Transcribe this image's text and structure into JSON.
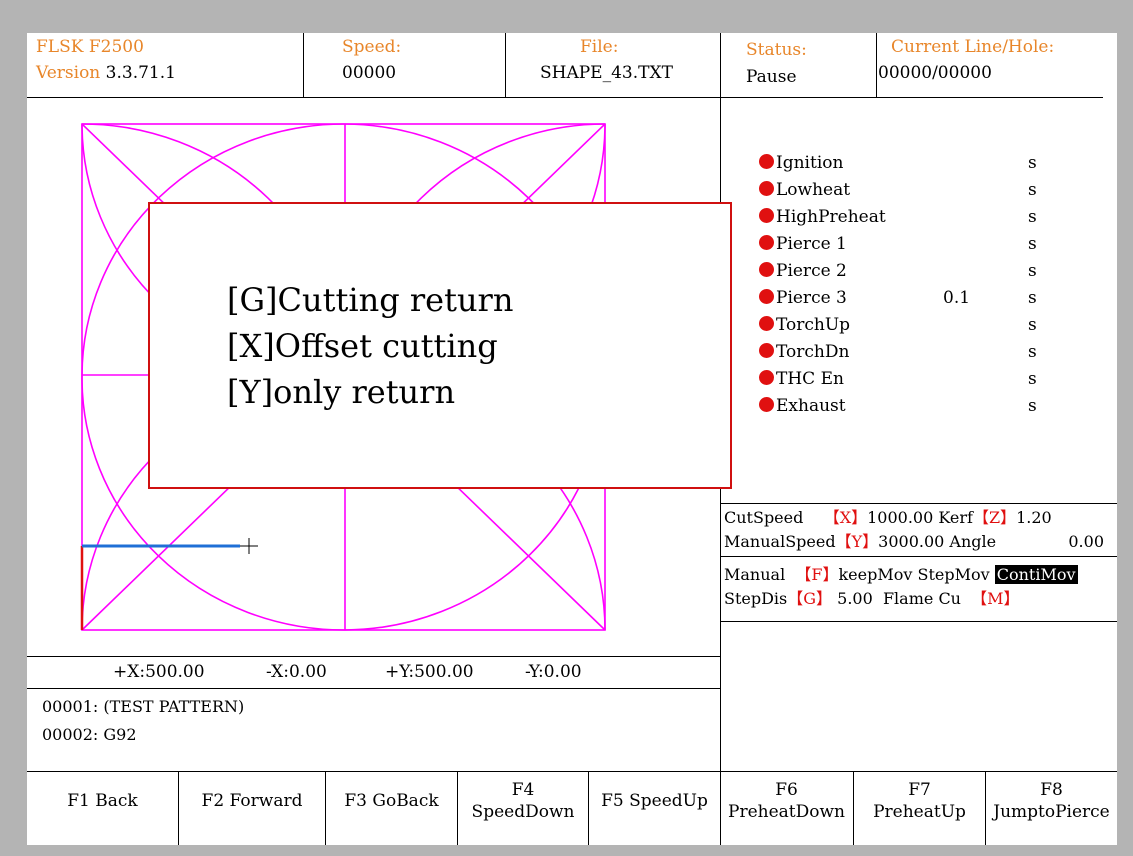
{
  "header": {
    "model": "FLSK F2500",
    "version_label": "Version",
    "version_value": "3.3.71.1",
    "speed_label": "Speed:",
    "speed_value": "00000",
    "file_label": "File:",
    "file_value": "SHAPE_43.TXT",
    "status_label": "Status:",
    "status_value": "Pause",
    "line_label": "Current Line/Hole:",
    "line_value": "00000/00000"
  },
  "dialog": {
    "items": [
      "[G]Cutting return",
      "[X]Offset cutting",
      "[Y]only return"
    ]
  },
  "io_items": [
    {
      "label": "Ignition",
      "value": "",
      "unit": "s"
    },
    {
      "label": "Lowheat",
      "value": "",
      "unit": "s"
    },
    {
      "label": "HighPreheat",
      "value": "",
      "unit": "s"
    },
    {
      "label": "Pierce 1",
      "value": "",
      "unit": "s"
    },
    {
      "label": "Pierce 2",
      "value": "",
      "unit": "s"
    },
    {
      "label": "Pierce 3",
      "value": "0.1",
      "unit": "s"
    },
    {
      "label": "TorchUp",
      "value": "",
      "unit": "s"
    },
    {
      "label": "TorchDn",
      "value": "",
      "unit": "s"
    },
    {
      "label": "THC En",
      "value": "",
      "unit": "s"
    },
    {
      "label": "Exhaust",
      "value": "",
      "unit": "s"
    }
  ],
  "params": {
    "cut_speed_label": "CutSpeed",
    "cut_speed_key": "【X】",
    "cut_speed_value": "1000.00",
    "kerf_label": "Kerf",
    "kerf_key": "【Z】",
    "kerf_value": "1.20",
    "manual_speed_label": "ManualSpeed",
    "manual_speed_key": "【Y】",
    "manual_speed_value": "3000.00",
    "angle_label": "Angle",
    "angle_value": "0.00"
  },
  "manual": {
    "label": "Manual",
    "key": "【F】",
    "keep": "keepMov",
    "step": "StepMov",
    "conti": "ContiMov",
    "stepdis_label": "StepDis",
    "stepdis_key": "【G】",
    "stepdis_value": "5.00",
    "flame_label": "Flame Cu",
    "flame_key": "【M】"
  },
  "limits": {
    "xpos": "+X:500.00",
    "xneg": "-X:0.00",
    "ypos": "+Y:500.00",
    "yneg": "-Y:0.00"
  },
  "code_lines": [
    "00001: (TEST PATTERN)",
    "00002: G92"
  ],
  "fkeys": [
    {
      "line1": "F1 Back",
      "line2": ""
    },
    {
      "line1": "F2 Forward",
      "line2": ""
    },
    {
      "line1": "F3 GoBack",
      "line2": ""
    },
    {
      "line1": "F4",
      "line2": "SpeedDown"
    },
    {
      "line1": "F5 SpeedUp",
      "line2": ""
    },
    {
      "line1": "F6",
      "line2": "PreheatDown"
    },
    {
      "line1": "F7",
      "line2": "PreheatUp"
    },
    {
      "line1": "F8",
      "line2": "JumptoPierce"
    }
  ],
  "colors": {
    "header_orange": "#e8862a",
    "indicator_red": "#e01010",
    "pattern_magenta": "#ff00ff",
    "path_blue": "#1f6fd6"
  }
}
